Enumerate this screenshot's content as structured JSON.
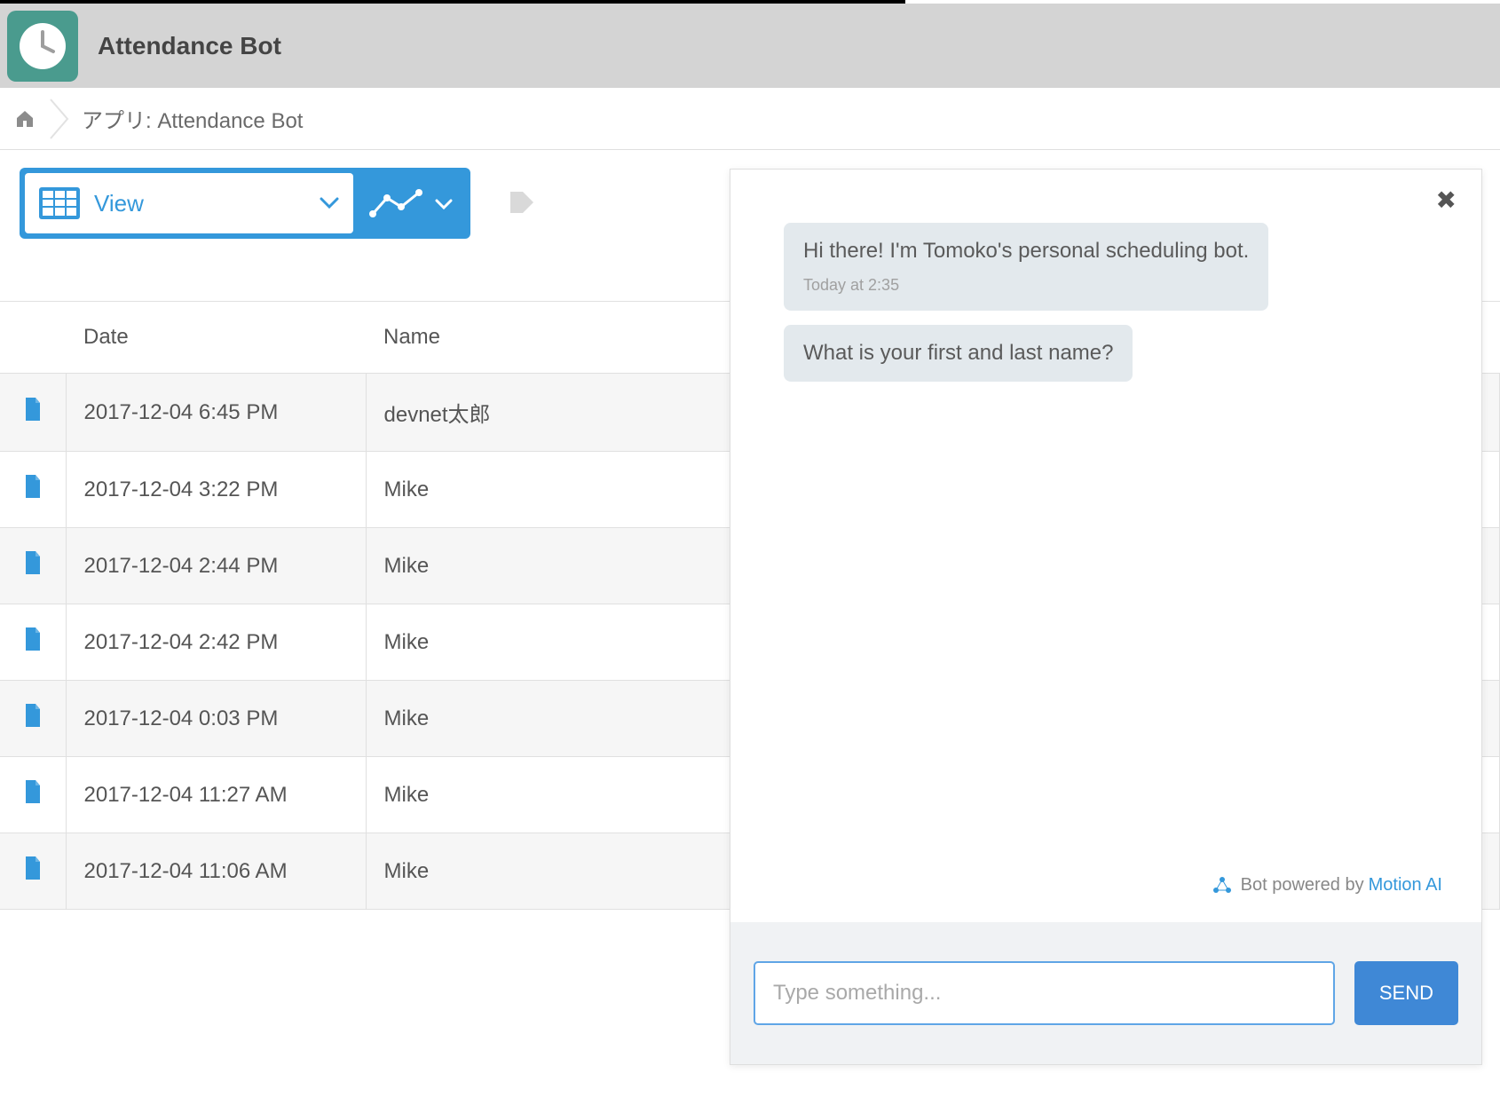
{
  "header": {
    "app_title": "Attendance Bot"
  },
  "breadcrumb": {
    "prefix": "アプリ:",
    "app_name": "Attendance Bot"
  },
  "toolbar": {
    "view_label": "View"
  },
  "table": {
    "columns": {
      "date": "Date",
      "name": "Name"
    },
    "rows": [
      {
        "date": "2017-12-04 6:45 PM",
        "name": "devnet太郎"
      },
      {
        "date": "2017-12-04 3:22 PM",
        "name": "Mike"
      },
      {
        "date": "2017-12-04 2:44 PM",
        "name": "Mike"
      },
      {
        "date": "2017-12-04 2:42 PM",
        "name": "Mike"
      },
      {
        "date": "2017-12-04 0:03 PM",
        "name": "Mike"
      },
      {
        "date": "2017-12-04 11:27 AM",
        "name": "Mike"
      },
      {
        "date": "2017-12-04 11:06 AM",
        "name": "Mike"
      }
    ]
  },
  "chat": {
    "messages": [
      {
        "text": "Hi there! I'm Tomoko's personal scheduling bot.",
        "time": "Today at 2:35"
      },
      {
        "text": "What is your first and last name?",
        "time": ""
      }
    ],
    "footer_prefix": "Bot powered by",
    "footer_link": "Motion AI",
    "input_placeholder": "Type something...",
    "send_label": "SEND"
  }
}
